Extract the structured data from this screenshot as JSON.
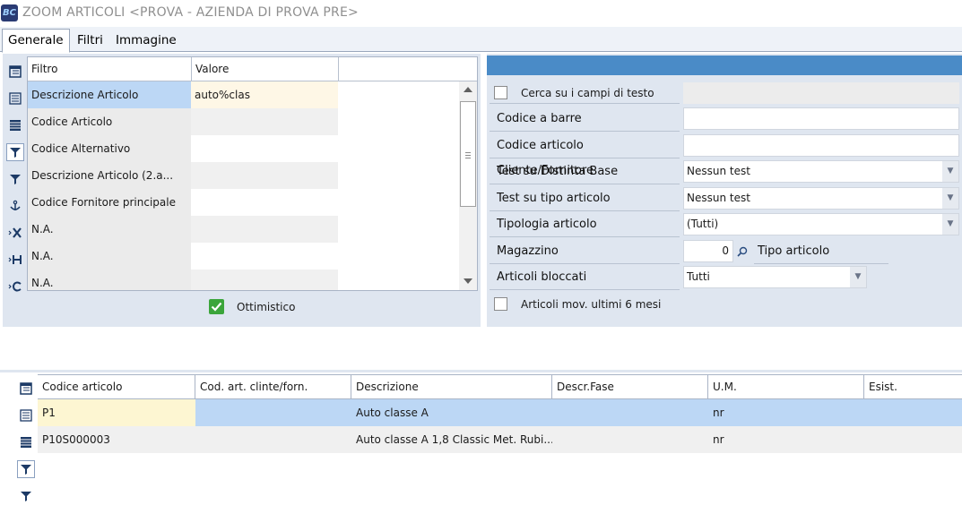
{
  "window": {
    "title": "ZOOM ARTICOLI <PROVA - AZIENDA DI PROVA PRE>",
    "app_icon_text": "BC"
  },
  "tabs": [
    {
      "label": "Generale",
      "active": true
    },
    {
      "label": "Filtri",
      "active": false
    },
    {
      "label": "Immagine",
      "active": false
    }
  ],
  "filter_grid": {
    "headers": [
      "Filtro",
      "Valore",
      ""
    ],
    "rows": [
      {
        "filtro": "Descrizione Articolo",
        "valore": "auto%clas"
      },
      {
        "filtro": "Codice Articolo",
        "valore": ""
      },
      {
        "filtro": "Codice Alternativo",
        "valore": ""
      },
      {
        "filtro": "Descrizione Articolo (2.a...",
        "valore": ""
      },
      {
        "filtro": "Codice Fornitore principale",
        "valore": ""
      },
      {
        "filtro": "N.A.",
        "valore": ""
      },
      {
        "filtro": "N.A.",
        "valore": ""
      },
      {
        "filtro": "N.A.",
        "valore": ""
      }
    ]
  },
  "ottimistico": {
    "label": "Ottimistico",
    "checked": true
  },
  "right_panel": {
    "cerca_label": "Cerca su i campi di testo",
    "fields": [
      {
        "label": "Codice a barre",
        "value": ""
      },
      {
        "label": "Codice articolo Cliente/Fornitore",
        "value": ""
      },
      {
        "label": "Test su Distinta Base",
        "value": "Nessun test"
      },
      {
        "label": "Test su tipo articolo",
        "value": "Nessun test"
      },
      {
        "label": "Tipologia articolo",
        "value": "(Tutti)"
      }
    ],
    "magazzino": {
      "label": "Magazzino",
      "value": "0",
      "extra_label": "Tipo articolo"
    },
    "bloccati": {
      "label": "Articoli bloccati",
      "value": "Tutti"
    },
    "movimentati_label": "Articoli mov. ultimi 6 mesi"
  },
  "results": {
    "headers": [
      "Codice articolo",
      "Cod. art. clinte/forn.",
      "Descrizione",
      "Descr.Fase",
      "U.M.",
      "Esist."
    ],
    "rows": [
      {
        "codice": "P1",
        "cod_forn": "",
        "descrizione": "Auto classe A",
        "fase": "",
        "um": "nr",
        "esist": ""
      },
      {
        "codice": "P10S000003",
        "cod_forn": "",
        "descrizione": "Auto classe A 1,8 Classic Met. Rubi...",
        "fase": "",
        "um": "nr",
        "esist": ""
      }
    ]
  },
  "colors": {
    "accent": "#4a8bc7",
    "selected_row": "#bcd7f5",
    "panel": "#dfe6f0",
    "value_highlight": "#fef7e6"
  }
}
